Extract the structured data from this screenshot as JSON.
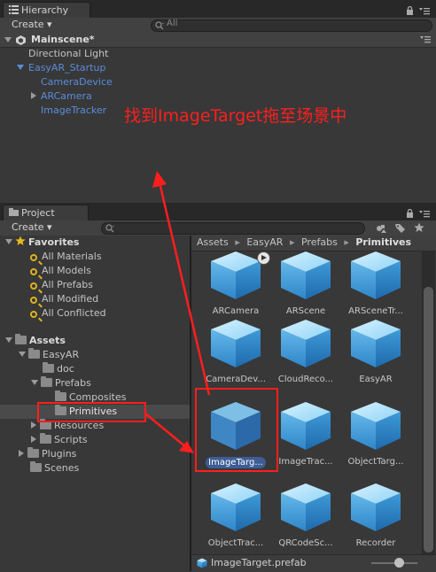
{
  "hierarchy": {
    "tab_label": "Hierarchy",
    "create_label": "Create ▾",
    "search_placeholder": "All",
    "scene_name": "Mainscene*",
    "items": [
      {
        "label": "Directional Light"
      },
      {
        "label": "EasyAR_Startup"
      },
      {
        "label": "CameraDevice"
      },
      {
        "label": "ARCamera"
      },
      {
        "label": "ImageTracker"
      }
    ]
  },
  "annotation": {
    "text": "找到ImageTarget拖至场景中",
    "color": "#ff1e1e"
  },
  "project": {
    "tab_label": "Project",
    "create_label": "Create ▾",
    "favorites": {
      "label": "Favorites",
      "items": [
        "All Materials",
        "All Models",
        "All Prefabs",
        "All Modified",
        "All Conflicted"
      ]
    },
    "assets": {
      "label": "Assets",
      "tree": [
        "EasyAR",
        "doc",
        "Prefabs",
        "Composites",
        "Primitives",
        "Resources",
        "Scripts",
        "Plugins",
        "Scenes"
      ]
    },
    "breadcrumb": [
      "Assets",
      "EasyAR",
      "Prefabs",
      "Primitives"
    ],
    "grid": [
      "ARCamera",
      "ARScene",
      "ARSceneTr...",
      "CameraDev...",
      "CloudReco...",
      "EasyAR",
      "ImageTarg...",
      "ImageTrac...",
      "ObjectTarg...",
      "ObjectTrac...",
      "QRCodeSc...",
      "Recorder"
    ],
    "selected_asset": "ImageTarg...",
    "status_file": "ImageTarget.prefab"
  },
  "colors": {
    "accent_blue": "#5a8cdc",
    "selection": "#3e5d95",
    "highlight_box": "#ff1e1e"
  }
}
